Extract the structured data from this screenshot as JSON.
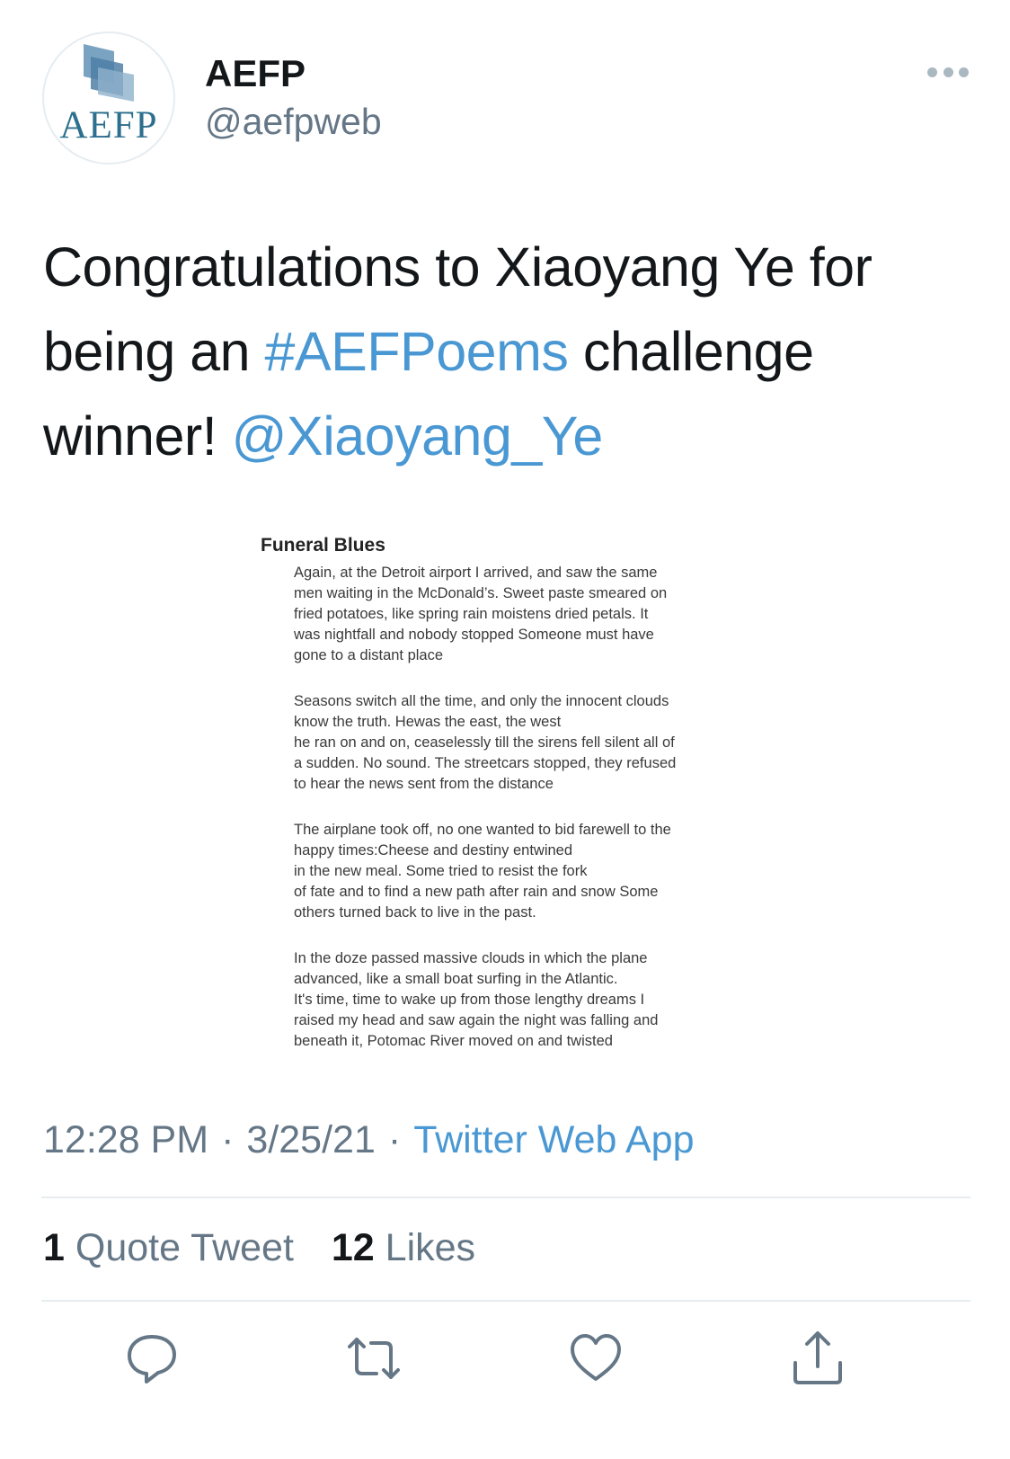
{
  "user": {
    "avatar_text": "AEFP",
    "name": "AEFP",
    "handle": "@aefpweb"
  },
  "tweet": {
    "text_part1": "Congratulations to Xiaoyang Ye for being an ",
    "hashtag": "#AEFPoems",
    "text_part2": " challenge winner! ",
    "mention": "@Xiaoyang_Ye"
  },
  "poem": {
    "title": "Funeral Blues",
    "stanzas": [
      [
        "Again, at the Detroit airport I arrived, and saw the same",
        "men waiting in the McDonald’s. Sweet paste smeared on",
        "fried potatoes, like spring rain moistens dried petals. It",
        "was nightfall and nobody stopped Someone must have",
        "gone to a distant place"
      ],
      [
        "Seasons switch all the time, and only the innocent clouds",
        "know the truth. Hewas the east, the west",
        "he ran on and on, ceaselessly till the sirens fell silent all of",
        "a sudden. No sound. The streetcars stopped, they refused",
        "to hear the news sent from the distance"
      ],
      [
        "The airplane took off, no one wanted to bid farewell to the",
        "happy times:Cheese and destiny entwined",
        "in the new meal. Some tried to resist the fork",
        "of fate and to find a new path after rain and snow Some",
        "others turned back to live in the past."
      ],
      [
        "In the doze passed massive clouds in which the plane",
        "advanced, like a small boat surfing in the Atlantic.",
        "It's time, time to wake up from those lengthy dreams I",
        "raised my head and saw again the night was falling and",
        "beneath it, Potomac River moved on and twisted"
      ]
    ]
  },
  "meta": {
    "time": "12:28 PM",
    "date": "3/25/21",
    "separator": "·",
    "source": "Twitter Web App"
  },
  "stats": {
    "quote_count": "1",
    "quote_label": "Quote Tweet",
    "like_count": "12",
    "like_label": "Likes"
  },
  "colors": {
    "link": "#4a98d3",
    "text": "#14171a",
    "muted": "#657786",
    "icon": "#657786"
  },
  "icons": [
    "more-icon",
    "reply-icon",
    "retweet-icon",
    "like-icon",
    "share-icon"
  ]
}
